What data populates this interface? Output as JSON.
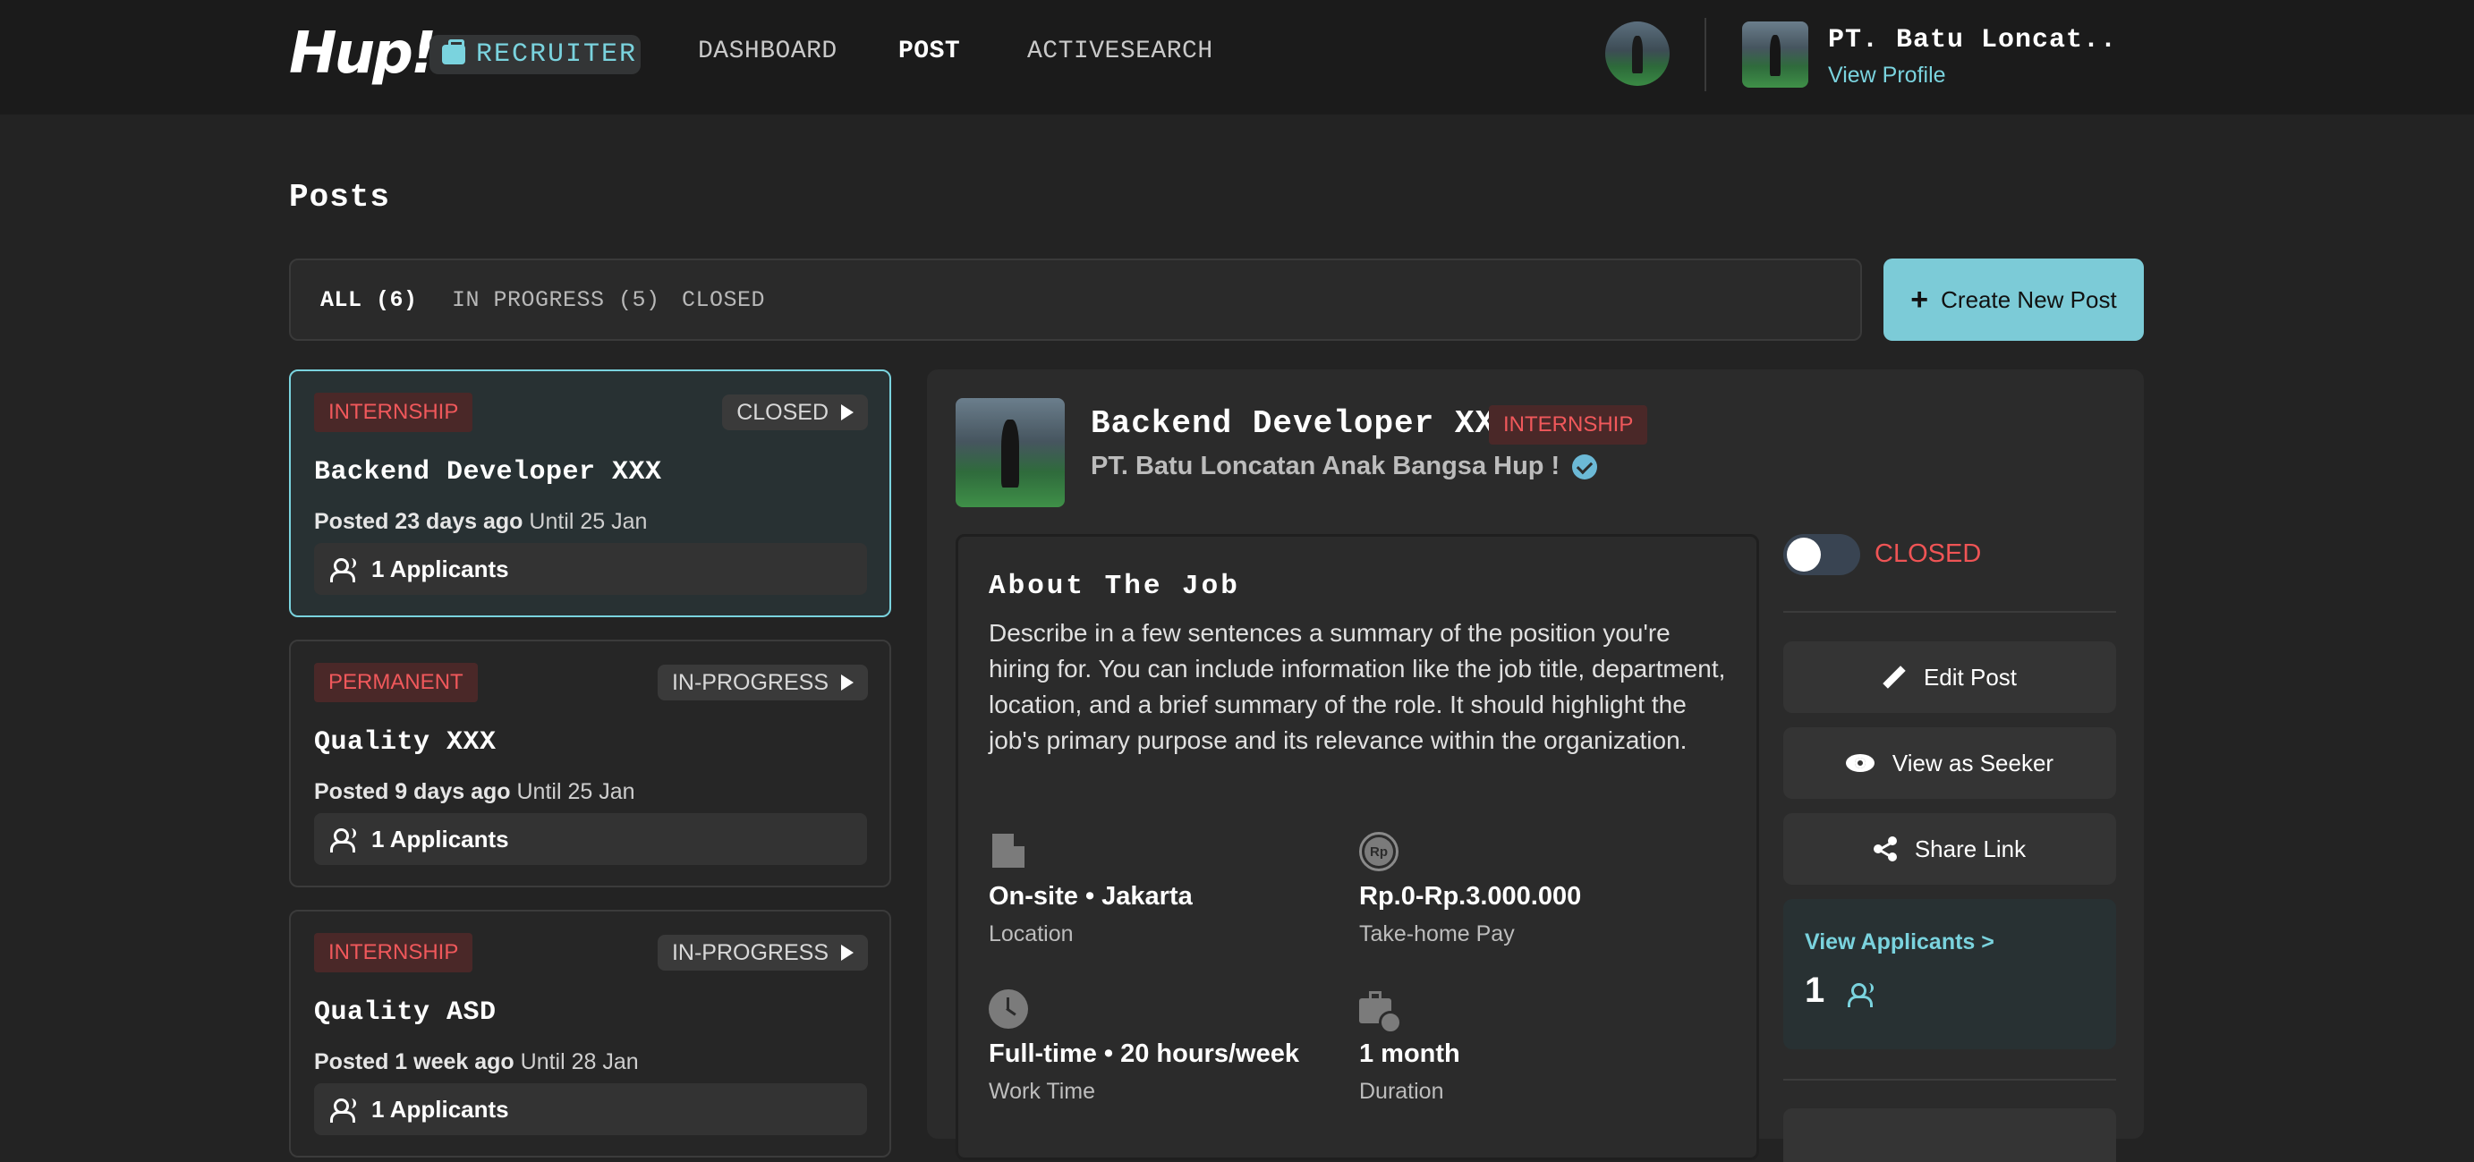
{
  "navbar": {
    "logo_text": "Hup!",
    "role_badge": "RECRUITER",
    "links": [
      "DASHBOARD",
      "POST",
      "ACTIVESEARCH"
    ],
    "active_link": "POST",
    "company_name": "PT. Batu Loncat..",
    "view_profile": "View Profile"
  },
  "page": {
    "title": "Posts"
  },
  "filters": {
    "tabs": [
      "ALL (6)",
      "IN PROGRESS (5)",
      "CLOSED"
    ],
    "active": "ALL (6)",
    "create_button": "Create New Post"
  },
  "posts": [
    {
      "type": "INTERNSHIP",
      "status": "CLOSED",
      "title": "Backend Developer XXX",
      "posted": "Posted 23 days ago",
      "until": "Until 25 Jan",
      "applicants": "1 Applicants",
      "selected": true
    },
    {
      "type": "PERMANENT",
      "status": "IN-PROGRESS",
      "title": "Quality XXX",
      "posted": "Posted 9 days ago",
      "until": "Until 25 Jan",
      "applicants": "1 Applicants",
      "selected": false
    },
    {
      "type": "INTERNSHIP",
      "status": "IN-PROGRESS",
      "title": "Quality ASD",
      "posted": "Posted 1 week ago",
      "until": "Until 28 Jan",
      "applicants": "1 Applicants",
      "selected": false
    }
  ],
  "detail": {
    "title": "Backend Developer XXX",
    "type": "INTERNSHIP",
    "company": "PT. Batu Loncatan Anak Bangsa Hup !",
    "about_title": "About The Job",
    "about_desc": "Describe in a few sentences a summary of the position you're hiring for. You can include information like the job title, department, location, and a brief summary of the role. It should highlight the job's primary purpose and its relevance within the organization.",
    "location_value": "On-site • Jakarta",
    "location_label": "Location",
    "pay_icon_text": "Rp",
    "pay_value": "Rp.0-Rp.3.000.000",
    "pay_label": "Take-home Pay",
    "worktime_value": "Full-time • 20 hours/week",
    "worktime_label": "Work Time",
    "duration_value": "1 month",
    "duration_label": "Duration",
    "status_toggle_label": "CLOSED",
    "status_toggle_on": false,
    "actions": {
      "edit": "Edit Post",
      "view_as_seeker": "View as Seeker",
      "share": "Share Link"
    },
    "view_applicants": "View Applicants >",
    "applicants_count": "1"
  },
  "colors": {
    "accent": "#7ad3de",
    "badge_red": "#f0585b",
    "background": "#232323",
    "navbar": "#1b1b1b"
  }
}
